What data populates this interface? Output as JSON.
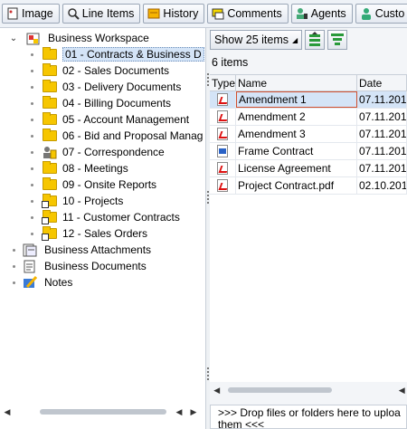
{
  "tabs": [
    {
      "label": "Image",
      "icon": "image-icon"
    },
    {
      "label": "Line Items",
      "icon": "line-items-icon"
    },
    {
      "label": "History",
      "icon": "history-icon"
    },
    {
      "label": "Comments",
      "icon": "comments-icon"
    },
    {
      "label": "Agents",
      "icon": "agents-icon"
    },
    {
      "label": "Custo",
      "icon": "customer-icon"
    }
  ],
  "tree": {
    "root_label": "Business Workspace",
    "folders": [
      {
        "label": "01 - Contracts & Business D",
        "selected": true,
        "link": false
      },
      {
        "label": "02 - Sales Documents",
        "link": false
      },
      {
        "label": "03 - Delivery Documents",
        "link": false
      },
      {
        "label": "04 - Billing Documents",
        "link": false
      },
      {
        "label": "05 - Account Management",
        "link": false
      },
      {
        "label": "06 - Bid and Proposal Manag",
        "link": false
      },
      {
        "label": "07 - Correspondence",
        "link": false,
        "special": "correspondence-icon"
      },
      {
        "label": "08 - Meetings",
        "link": false
      },
      {
        "label": "09 - Onsite Reports",
        "link": false
      },
      {
        "label": "10 - Projects",
        "link": true
      },
      {
        "label": "11 - Customer Contracts",
        "link": true
      },
      {
        "label": "12 - Sales Orders",
        "link": true
      }
    ],
    "siblings": [
      {
        "label": "Business Attachments",
        "icon": "attachments-icon"
      },
      {
        "label": "Business Documents",
        "icon": "documents-icon"
      },
      {
        "label": "Notes",
        "icon": "notes-icon"
      }
    ]
  },
  "toolbar": {
    "show_label": "Show 25  items",
    "dropdown_arrow": "◢"
  },
  "count_label": "6  items",
  "grid": {
    "columns": [
      "Type",
      "Name",
      "Date"
    ],
    "rows": [
      {
        "type": "pdf",
        "name": "Amendment 1",
        "date": "07.11.201"
      },
      {
        "type": "pdf",
        "name": "Amendment 2",
        "date": "07.11.201"
      },
      {
        "type": "pdf",
        "name": "Amendment 3",
        "date": "07.11.201"
      },
      {
        "type": "word",
        "name": "Frame Contract",
        "date": "07.11.201"
      },
      {
        "type": "pdf",
        "name": "License Agreement",
        "date": "07.11.201"
      },
      {
        "type": "pdf",
        "name": "Project Contract.pdf",
        "date": "02.10.201"
      }
    ]
  },
  "dropzone_text": ">>> Drop files or folders here to uploa them <<<",
  "colors": {
    "selection": "#d4e4f7",
    "folder": "#f6c600",
    "pdf_red": "#d11111"
  }
}
